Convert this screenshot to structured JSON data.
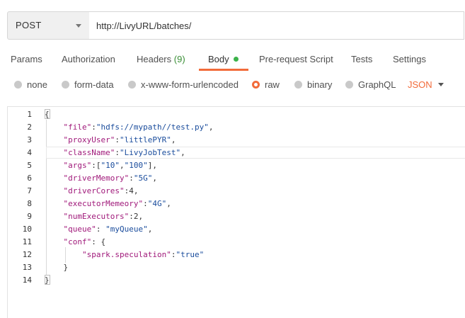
{
  "request": {
    "method": "POST",
    "url": "http://LivyURL/batches/"
  },
  "tabs": [
    {
      "label": "Params"
    },
    {
      "label": "Authorization"
    },
    {
      "label": "Headers",
      "count": "(9)"
    },
    {
      "label": "Body",
      "active": true
    },
    {
      "label": "Pre-request Script"
    },
    {
      "label": "Tests"
    },
    {
      "label": "Settings"
    }
  ],
  "body_types": {
    "options": [
      "none",
      "form-data",
      "x-www-form-urlencoded",
      "raw",
      "binary",
      "GraphQL"
    ],
    "selected": "raw",
    "format": "JSON"
  },
  "editor": {
    "line_numbers": [
      "1",
      "2",
      "3",
      "4",
      "5",
      "6",
      "7",
      "8",
      "9",
      "10",
      "11",
      "12",
      "13",
      "14"
    ],
    "lines": [
      "{",
      "    \"file\":\"hdfs://mypath//test.py\",",
      "    \"proxyUser\":\"littlePYR\",",
      "    \"className\":\"LivyJobTest\",",
      "    \"args\":[\"10\",\"100\"],",
      "    \"driverMemory\":\"5G\",",
      "    \"driverCores\":4,",
      "    \"executorMemeory\":\"4G\",",
      "    \"numExecutors\":2,",
      "    \"queue\": \"myQueue\",",
      "    \"conf\": {",
      "        \"spark.speculation\":\"true\"",
      "    }",
      "}"
    ]
  },
  "colors": {
    "accent": "#f26b3a",
    "dot_green": "#3bb24a",
    "key": "#a0197a",
    "string": "#1a4c9c"
  }
}
